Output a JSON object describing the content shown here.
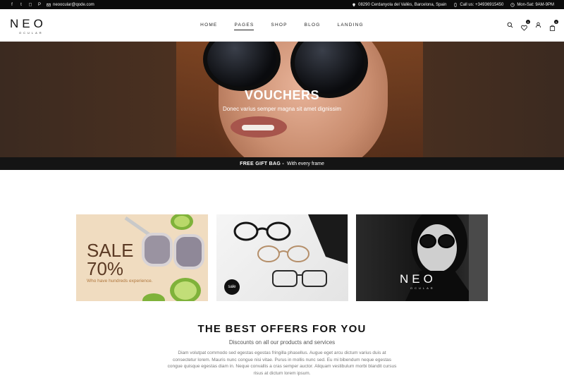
{
  "topbar": {
    "email": "neoocular@qode.com",
    "address": "08290 Cerdanyola del Vallès, Barcelona, Spain",
    "phone": "Call us: +34936915450",
    "hours": "Mon-Sat: 9AM-9PM",
    "social": [
      {
        "icon": "facebook-icon",
        "glyph": "f"
      },
      {
        "icon": "twitter-icon",
        "glyph": "t"
      },
      {
        "icon": "instagram-icon",
        "glyph": "◻"
      },
      {
        "icon": "pinterest-icon",
        "glyph": "P"
      }
    ]
  },
  "header": {
    "logo": "NEO",
    "logo_sub": "OCULAR",
    "nav": [
      "HOME",
      "PAGES",
      "SHOP",
      "BLOG",
      "LANDING"
    ],
    "active_nav": "PAGES",
    "wishlist_count": "0",
    "cart_count": "0"
  },
  "hero": {
    "title": "VOUCHERS",
    "subtitle": "Donec varius semper magna sit amet dignissim"
  },
  "promo": {
    "bold": "FREE GIFT BAG -",
    "text": "With every frame"
  },
  "cards": [
    {
      "sale_title_1": "SALE",
      "sale_title_2": "70%",
      "sale_text": "Who have hundreds experience."
    },
    {
      "badge": "sale"
    },
    {
      "logo": "NEO",
      "logo_sub": "OCULAR"
    }
  ],
  "offers": {
    "title": "THE BEST OFFERS FOR YOU",
    "subtitle": "Discounts on all our products and services",
    "body": "Diam volutpat commodo sed egestas egestas fringilla phasellus. Augue eget arcu dictum varius duis at consectetur lorem. Mauris nunc congue nisi vitae. Purus in mollis nunc sed. Eu mi bibendum neque egestas congue quisque egestas diam in. Neque convallis a cras semper auctor. Aliquam vestibulum morbi blandit cursus risus at dictum lorem ipsum."
  },
  "colors": {
    "topbar_bg": "#0b0b0b",
    "strip_bg": "#141414",
    "sale_brown": "#5b3a24",
    "sale_accent": "#b0773d"
  }
}
